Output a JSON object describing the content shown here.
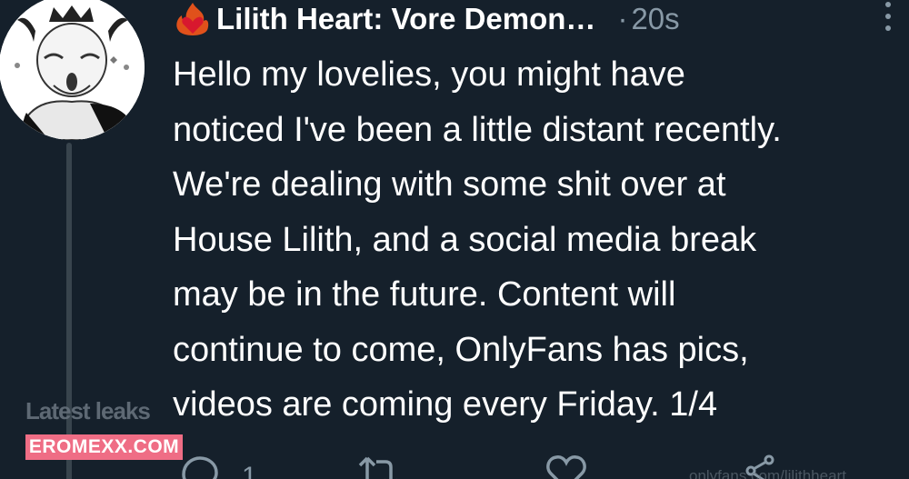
{
  "tweet": {
    "author": {
      "display_name": "Lilith Heart: Vore Demon…",
      "name_emoji": "fire-heart-emoji"
    },
    "separator": "·",
    "timestamp": "20s",
    "text": "Hello my lovelies, you might have\nnoticed I've been a little distant recently.\nWe're dealing with some shit over at\nHouse Lilith, and a social media break\nmay be in the future. Content will\ncontinue to come, OnlyFans has pics,\nvideos are coming every Friday. 1/4",
    "actions": {
      "reply_count": "1"
    }
  },
  "watermark": {
    "line1": "Latest leaks",
    "line2": "EROMEXX.COM",
    "link_text": "onlyfans.com/lilithheart"
  },
  "colors": {
    "background": "#15202b",
    "text": "#ffffff",
    "secondary": "#8899a6",
    "badge": "#ef6d85"
  },
  "icons": [
    "more-icon",
    "reply-icon",
    "retweet-icon",
    "like-icon",
    "share-icon"
  ]
}
